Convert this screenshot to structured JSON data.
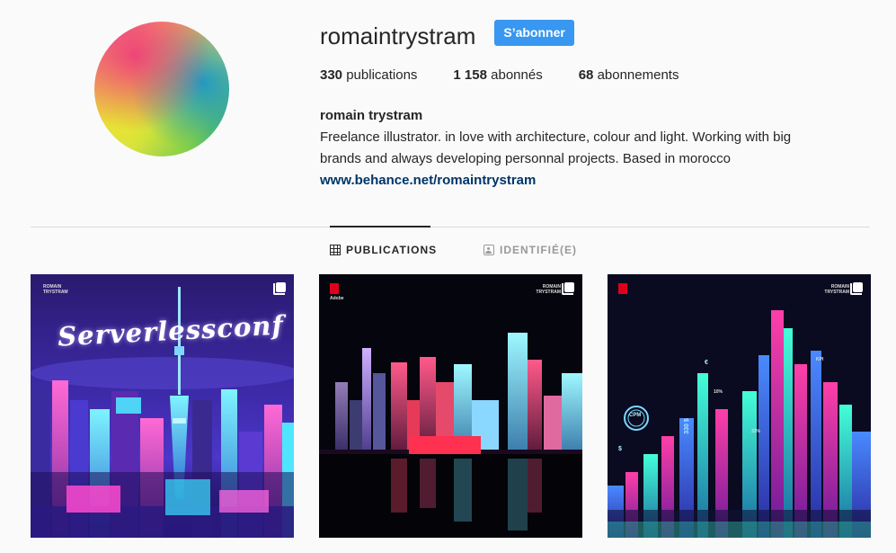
{
  "profile": {
    "username": "romaintrystram",
    "follow_label": "S’abonner",
    "stats": [
      {
        "count": "330",
        "label": "publications"
      },
      {
        "count": "1 158",
        "label": "abonnés"
      },
      {
        "count": "68",
        "label": "abonnements"
      }
    ],
    "full_name": "romain trystram",
    "bio_line1": "Freelance illustrator. in love with architecture, colour and light. Working with big",
    "bio_line2": "brands and always developing personnal projects. Based in morocco",
    "website": "www.behance.net/romaintrystram"
  },
  "tabs": [
    {
      "label": "PUBLICATIONS",
      "icon": "grid-icon",
      "active": true
    },
    {
      "label": "IDENTIFIÉ(E)",
      "icon": "tag-icon",
      "active": false
    }
  ],
  "posts": [
    {
      "title_text": "Serverlessconf",
      "brand_line1": "ROMAIN",
      "brand_line2": "TRYSTRAM",
      "multi": true
    },
    {
      "brand_line1": "ROMAIN",
      "brand_line2": "TRYSTRAM",
      "adobe": "Adobe",
      "multi": true
    },
    {
      "brand_line1": "ROMAIN",
      "brand_line2": "TRYSTRAM",
      "chart_labels": [
        "CPM",
        "330 $",
        "$",
        "€",
        "10%",
        "33%",
        "KPI"
      ],
      "multi": true
    }
  ],
  "colors": {
    "accent": "#3897f0",
    "link": "#003569",
    "divider": "#dbdbdb"
  }
}
